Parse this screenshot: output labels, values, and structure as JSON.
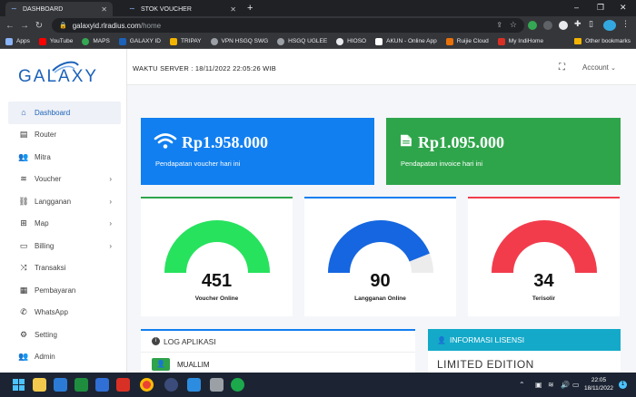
{
  "browser": {
    "tabs": [
      {
        "label": "DASHBOARD",
        "active": true
      },
      {
        "label": "STOK VOUCHER",
        "active": false
      }
    ],
    "url_host": "galaxyid.rlradius.com",
    "url_path": "/home",
    "bookmarks": [
      {
        "label": "Apps",
        "color": "#8ab4f8"
      },
      {
        "label": "YouTube",
        "color": "#ff0000"
      },
      {
        "label": "MAPS",
        "color": "#34a853"
      },
      {
        "label": "GALAXY ID",
        "color": "#1c62b9"
      },
      {
        "label": "TRIPAY",
        "color": "#f2b400"
      },
      {
        "label": "VPN HSGQ SWG",
        "color": "#9aa0a6"
      },
      {
        "label": "HSGQ UGLEE",
        "color": "#9aa0a6"
      },
      {
        "label": "HIOSO",
        "color": "#e8eaed"
      },
      {
        "label": "AKUN - Online App",
        "color": "#ffffff"
      },
      {
        "label": "Ruijie Cloud",
        "color": "#e8710a"
      },
      {
        "label": "My IndiHome",
        "color": "#d93025"
      }
    ],
    "other_bookmarks": "Other bookmarks"
  },
  "app": {
    "logo_text": "GALAXY",
    "server_time": "WAKTU SERVER : 18/11/2022 22:05:26 WIB",
    "account_label": "Account",
    "menu": [
      {
        "label": "Dashboard",
        "icon": "home-icon",
        "glyph": "⌂",
        "chevron": false,
        "active": true
      },
      {
        "label": "Router",
        "icon": "server-icon",
        "glyph": "▤",
        "chevron": false,
        "active": false
      },
      {
        "label": "Mitra",
        "icon": "users-icon",
        "glyph": "👥",
        "chevron": false,
        "active": false
      },
      {
        "label": "Voucher",
        "icon": "wifi-icon",
        "glyph": "≋",
        "chevron": true,
        "active": false
      },
      {
        "label": "Langganan",
        "icon": "link-icon",
        "glyph": "⛓",
        "chevron": true,
        "active": false
      },
      {
        "label": "Map",
        "icon": "sitemap-icon",
        "glyph": "⊞",
        "chevron": true,
        "active": false
      },
      {
        "label": "Billing",
        "icon": "wallet-icon",
        "glyph": "▭",
        "chevron": true,
        "active": false
      },
      {
        "label": "Transaksi",
        "icon": "shuffle-icon",
        "glyph": "⤨",
        "chevron": false,
        "active": false
      },
      {
        "label": "Pembayaran",
        "icon": "receipt-icon",
        "glyph": "▦",
        "chevron": false,
        "active": false
      },
      {
        "label": "WhatsApp",
        "icon": "whatsapp-icon",
        "glyph": "✆",
        "chevron": false,
        "active": false
      },
      {
        "label": "Setting",
        "icon": "gear-icon",
        "glyph": "⚙",
        "chevron": false,
        "active": false
      },
      {
        "label": "Admin",
        "icon": "user-group-icon",
        "glyph": "👥",
        "chevron": false,
        "active": false
      }
    ],
    "cards": [
      {
        "value": "Rp1.958.000",
        "caption": "Pendapatan voucher hari ini",
        "color": "#117ff0"
      },
      {
        "value": "Rp1.095.000",
        "caption": "Pendapatan invoice hari ini",
        "color": "#2fa54b"
      }
    ],
    "gauges": [
      {
        "value": "451",
        "label": "Voucher Online",
        "fraction": 1.0,
        "color": "#27e25d",
        "top_color": "#2fa54b"
      },
      {
        "value": "90",
        "label": "Langganan Online",
        "fraction": 0.88,
        "color": "#1566e0",
        "top_color": "#117ff0"
      },
      {
        "value": "34",
        "label": "Terisolir",
        "fraction": 1.0,
        "color": "#f23c4c",
        "top_color": "#f23c4c"
      }
    ],
    "log_panel": {
      "title": "LOG APLIKASI",
      "row_name": "MUALLIM",
      "row_avatar": "👤"
    },
    "license_panel": {
      "title": "INFORMASI LISENSI",
      "edition": "LIMITED EDITION",
      "color": "#14a9c9"
    }
  },
  "taskbar": {
    "time": "22:05",
    "date": "18/11/2022"
  }
}
